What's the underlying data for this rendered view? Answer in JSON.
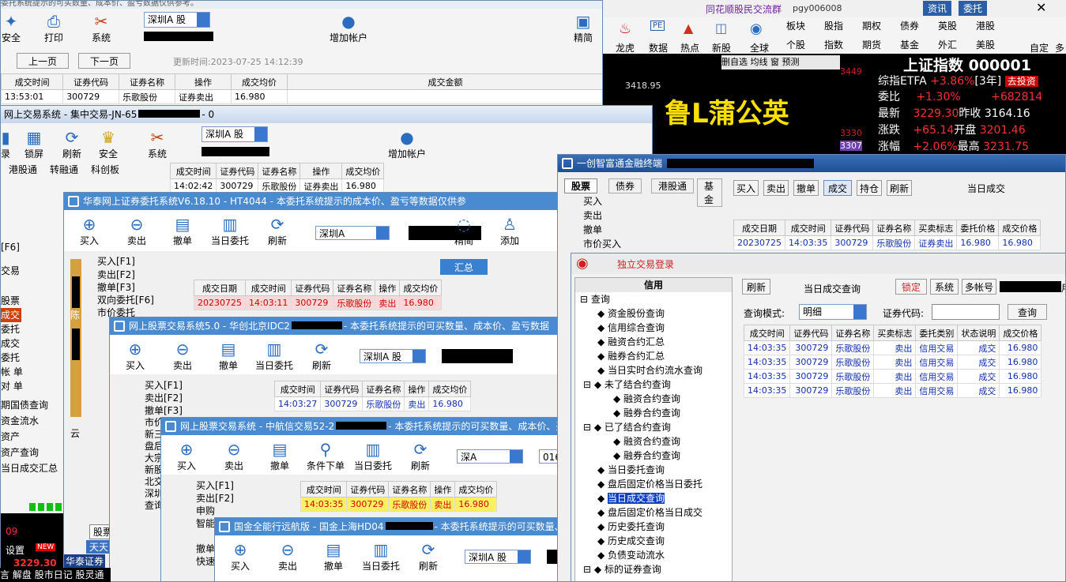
{
  "w1": {
    "notice": "委托系统提示的可买数量、成本价、盈亏数据仅供参考。",
    "toolbar": [
      "安全",
      "打印",
      "系统"
    ],
    "market": "深圳A 股",
    "add_account": "增加帐户",
    "jingjian": "精简",
    "prev": "上一页",
    "next": "下一页",
    "updated": "更新时间:2023-07-25 14:12:39",
    "headers": [
      "成交时间",
      "证券代码",
      "证券名称",
      "操作",
      "成交均价",
      "成交金额"
    ],
    "row": [
      "13:53:01",
      "300729",
      "乐歌股份",
      "证券卖出",
      "16.980"
    ]
  },
  "w2": {
    "title": "网上交易系统 - 集中交易-JN-65",
    "title_suffix": "- 0",
    "toolbar": [
      "录",
      "锁屏",
      "刷新",
      "安全",
      "系统"
    ],
    "market": "深圳A 股",
    "add_account": "增加帐户",
    "jingjian": "精简",
    "tabs": [
      "港股通",
      "转融通",
      "科创板"
    ],
    "headers": [
      "成交时间",
      "证券代码",
      "证券名称",
      "操作",
      "成交均价"
    ],
    "row": [
      "14:02:42",
      "300729",
      "乐歌股份",
      "证券卖出",
      "16.980"
    ],
    "left_items": [
      "[F6]",
      "交易",
      "股票",
      "成交",
      "委托",
      "成交",
      "委托",
      "帐 单",
      "对 单",
      "期国债查询",
      "资金流水",
      "资产",
      "资产查询",
      "当日成交汇总"
    ]
  },
  "w3": {
    "title": "华泰网上证券委托系统V6.18.10 - HT4044 - 本委托系统提示的成本价、盈亏等数据仅供参",
    "toolbar": [
      "买入",
      "卖出",
      "撤单",
      "当日委托",
      "刷新",
      "精简",
      "添加"
    ],
    "market": "深圳A",
    "summary": "汇总",
    "tree": [
      "买入[F1]",
      "卖出[F2]",
      "撤单[F3]",
      "双向委托[F6]",
      "市价委托"
    ],
    "headers": [
      "成交日期",
      "成交时间",
      "证券代码",
      "证券名称",
      "操作",
      "成交均价"
    ],
    "row": [
      "20230725",
      "14:03:11",
      "300729",
      "乐歌股份",
      "卖出",
      "16.980"
    ],
    "side": "陈",
    "side2": "云",
    "bottom_tab": "股票",
    "brand": "华泰证券",
    "extra": "天天"
  },
  "w4": {
    "title": "网上股票交易系统5.0 - 华创北京IDC2",
    "title_suffix": "- 本委托系统提示的可买数量、成本价、盈亏数据",
    "toolbar": [
      "买入",
      "卖出",
      "撤单",
      "当日委托",
      "刷新"
    ],
    "market": "深圳A 股",
    "tree": [
      "买入[F1]",
      "卖出[F2]",
      "撤单[F3]",
      "市价",
      "新三",
      "盘后",
      "大宗",
      "新股",
      "北交",
      "深圳",
      "查询"
    ],
    "headers": [
      "成交时间",
      "证券代码",
      "证券名称",
      "操作",
      "成交均价"
    ],
    "row": [
      "14:03:27",
      "300729",
      "乐歌股份",
      "卖出",
      "16.980"
    ]
  },
  "w5": {
    "title": "网上股票交易系统 - 中航信交易52-2",
    "title_suffix": "- 本委托系统提示的可买数量、成本价、盈亏数据",
    "toolbar": [
      "买入",
      "卖出",
      "撤单",
      "条件下单",
      "当日委托",
      "刷新"
    ],
    "market": "深A",
    "code_prefix": "016",
    "tree": [
      "买入[F1]",
      "卖出[F2]",
      "申购",
      "智能",
      "撤单",
      "快速"
    ],
    "headers": [
      "成交时间",
      "证券代码",
      "证券名称",
      "操作",
      "成交均价"
    ],
    "row": [
      "14:03:35",
      "300729",
      "乐歌股份",
      "卖出",
      "16.980"
    ]
  },
  "w6": {
    "title": "国金全能行远航版 - 国金上海HD04",
    "title_suffix": "- 本委托系统提示的可买数量、成",
    "toolbar": [
      "买入",
      "卖出",
      "撤单",
      "当日委托",
      "刷新"
    ],
    "market": "深圳A 股"
  },
  "ths": {
    "group": "同花顺股民交流群",
    "user": "pgy006008",
    "menu": [
      "资讯",
      "委托"
    ],
    "icons1": [
      "龙虎",
      "数据",
      "热点",
      "新股",
      "全球"
    ],
    "icons2": [
      "板块",
      "股指",
      "期权",
      "债券",
      "英股",
      "港股",
      "自定"
    ],
    "icons3": [
      "个股",
      "指数",
      "期货",
      "基金",
      "外汇",
      "美股",
      "多"
    ],
    "subbar": [
      "删自选",
      "均线",
      "窗",
      "预测"
    ],
    "index_title": "上证指数 000001",
    "price_label": "3418.95",
    "y1": "3449",
    "y2": "3330",
    "y3": "3307",
    "big_text": "鲁L蒲公英",
    "etf": "综指ETFA",
    "etf_pct": "+3.86%",
    "etf_term": "[3年]",
    "invest": "去投资",
    "rows": [
      [
        "委比",
        "+1.30%",
        "+682814"
      ],
      [
        "最新",
        "3229.30",
        "昨收",
        "3164.16"
      ],
      [
        "涨跌",
        "+65.14",
        "开盘",
        "3201.46"
      ],
      [
        "涨幅",
        "+2.06%",
        "最高",
        "3231.75"
      ]
    ]
  },
  "yc": {
    "title": "一创智富通金融终端",
    "tabs": [
      "股票",
      "债券",
      "港股通",
      "基金"
    ],
    "actions": [
      "买入",
      "卖出",
      "撤单",
      "成交",
      "持仓",
      "刷新"
    ],
    "heading": "当日成交",
    "tree": [
      "买入",
      "卖出",
      "撤单",
      "市价买入"
    ],
    "headers": [
      "成交日期",
      "成交时间",
      "证券代码",
      "证券名称",
      "买卖标志",
      "委托价格",
      "成交价格"
    ],
    "row": [
      "20230725",
      "14:03:35",
      "300729",
      "乐歌股份",
      "证券卖出",
      "16.980",
      "16.980"
    ]
  },
  "dl": {
    "title": "独立交易登录",
    "credit": "信用",
    "refresh": "刷新",
    "query_title": "当日成交查询",
    "lock": "锁定",
    "system": "系统",
    "multi": "多帐号",
    "use": "用",
    "mode_label": "查询模式:",
    "mode": "明细",
    "code_label": "证券代码:",
    "query_btn": "查询",
    "tree": [
      "查询",
      "资金股份查询",
      "信用综合查询",
      "融资合约汇总",
      "融券合约汇总",
      "当日实时合约流水查询",
      "未了结合约查询",
      "融资合约查询",
      "融券合约查询",
      "已了结合约查询",
      "融资合约查询",
      "融券合约查询",
      "当日委托查询",
      "盘后固定价格当日委托",
      "当日成交查询",
      "盘后固定价格当日成交",
      "历史委托查询",
      "历史成交查询",
      "负债变动流水",
      "标的证券查询"
    ],
    "headers": [
      "成交时间",
      "证券代码",
      "证券名称",
      "买卖标志",
      "委托类别",
      "状态说明",
      "成交价格"
    ],
    "rows": [
      [
        "14:03:35",
        "300729",
        "乐歌股份",
        "卖出",
        "信用交易",
        "成交",
        "16.980"
      ],
      [
        "14:03:35",
        "300729",
        "乐歌股份",
        "卖出",
        "信用交易",
        "成交",
        "16.980"
      ],
      [
        "14:03:35",
        "300729",
        "乐歌股份",
        "卖出",
        "信用交易",
        "成交",
        "16.980"
      ],
      [
        "14:03:35",
        "300729",
        "乐歌股份",
        "卖出",
        "信用交易",
        "成交",
        "16.980"
      ]
    ]
  },
  "bottom": {
    "nums": "09",
    "settings": "设置",
    "new": "NEW",
    "price": "3229.30",
    "links": [
      "言",
      "解盘",
      "股市日记",
      "股灵通"
    ]
  }
}
